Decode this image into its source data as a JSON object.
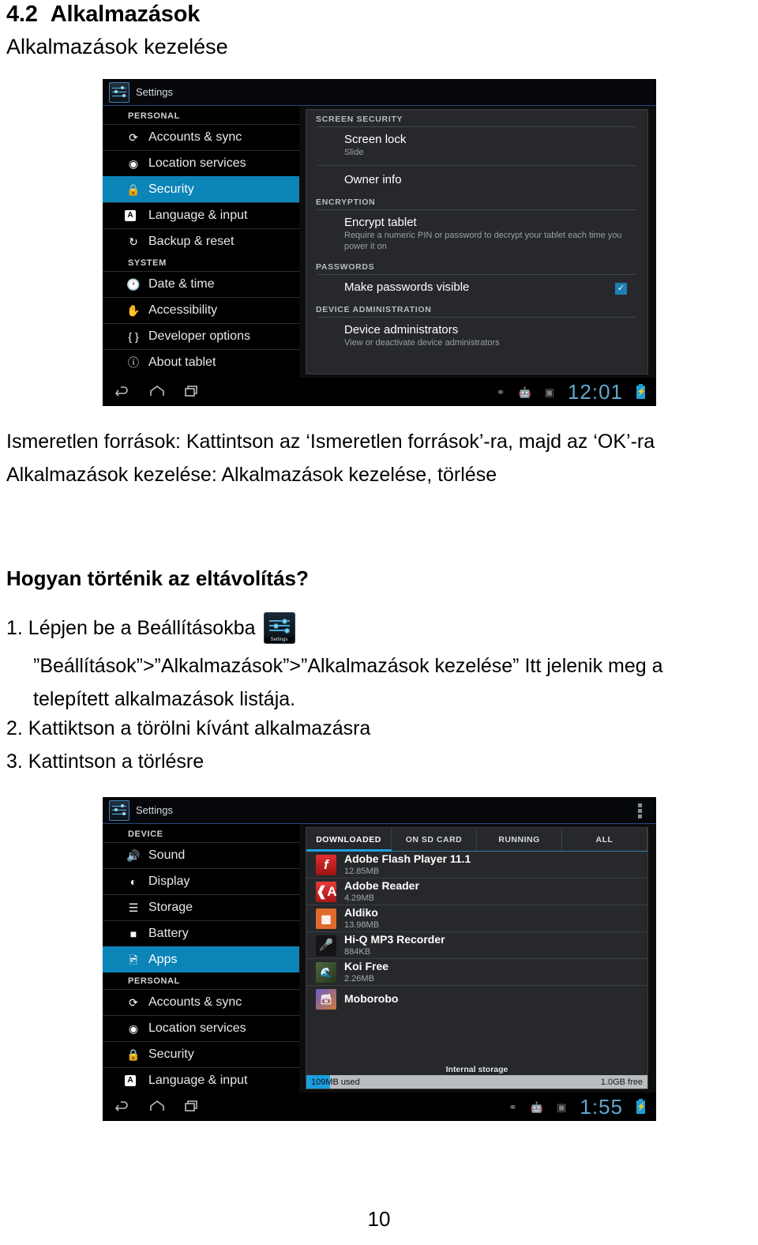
{
  "document": {
    "section_number": "4.2",
    "section_title": "Alkalmazások",
    "subtitle": "Alkalmazások kezelése",
    "paragraph_unknown_sources": "Ismeretlen források: Kattintson az ‘Ismeretlen források’-ra, majd az ‘OK’-ra",
    "paragraph_manage_apps": "Alkalmazások kezelése: Alkalmazások kezelése, törlése",
    "question_heading": "Hogyan történik az eltávolítás?",
    "step1_text": "1. Lépjen be a Beállításokba",
    "step1_icon_caption": "Settings",
    "step1_path": "”Beállítások”>”Alkalmazások”>”Alkalmazások kezelése” Itt jelenik meg a",
    "step1_path_cont": "telepített alkalmazások listája.",
    "step2_text": "2. Kattiktson a törölni kívánt alkalmazásra",
    "step3_text": "3. Kattintson a törlésre",
    "page_number": "10"
  },
  "colors": {
    "accent_blue": "#0b84b8",
    "tab_blue": "#1ca0e0",
    "clock_blue": "#5fa8cf",
    "panel_bg": "#26282b"
  },
  "screenshot_security": {
    "actionbar": {
      "title": "Settings",
      "icon": "settings-sliders-icon"
    },
    "sidebar": [
      {
        "type": "header",
        "label": "PERSONAL"
      },
      {
        "type": "item",
        "label": "Accounts & sync",
        "icon": "sync-icon",
        "selected": false
      },
      {
        "type": "item",
        "label": "Location services",
        "icon": "location-icon",
        "selected": false
      },
      {
        "type": "item",
        "label": "Security",
        "icon": "lock-icon",
        "selected": true
      },
      {
        "type": "item",
        "label": "Language & input",
        "icon": "keyboard-a-icon",
        "selected": false
      },
      {
        "type": "item",
        "label": "Backup & reset",
        "icon": "backup-restore-icon",
        "selected": false
      },
      {
        "type": "header",
        "label": "SYSTEM"
      },
      {
        "type": "item",
        "label": "Date & time",
        "icon": "clock-icon",
        "selected": false
      },
      {
        "type": "item",
        "label": "Accessibility",
        "icon": "hand-icon",
        "selected": false
      },
      {
        "type": "item",
        "label": "Developer options",
        "icon": "braces-icon",
        "selected": false
      },
      {
        "type": "item",
        "label": "About tablet",
        "icon": "info-icon",
        "selected": false
      }
    ],
    "content": [
      {
        "kind": "header",
        "label": "SCREEN SECURITY"
      },
      {
        "kind": "row",
        "title": "Screen lock",
        "subtitle": "Slide",
        "checkbox": null
      },
      {
        "kind": "row",
        "title": "Owner info",
        "subtitle": "",
        "checkbox": null
      },
      {
        "kind": "header",
        "label": "ENCRYPTION"
      },
      {
        "kind": "row",
        "title": "Encrypt tablet",
        "subtitle": "Require a numeric PIN or password to decrypt your tablet each time you power it on",
        "checkbox": null
      },
      {
        "kind": "header",
        "label": "PASSWORDS"
      },
      {
        "kind": "row",
        "title": "Make passwords visible",
        "subtitle": "",
        "checkbox": "checked"
      },
      {
        "kind": "header",
        "label": "DEVICE ADMINISTRATION"
      },
      {
        "kind": "row",
        "title": "Device administrators",
        "subtitle": "View or deactivate device administrators",
        "checkbox": null
      }
    ],
    "statusbar": {
      "clock": "12:01",
      "icons": [
        "usb-icon",
        "android-debug-icon",
        "sd-card-icon"
      ],
      "battery": "battery-charging-icon",
      "nav": [
        "back-icon",
        "home-icon",
        "recents-icon"
      ]
    }
  },
  "screenshot_apps": {
    "actionbar": {
      "title": "Settings",
      "icon": "settings-sliders-icon",
      "overflow": "overflow-menu-icon"
    },
    "sidebar": [
      {
        "type": "header",
        "label": "DEVICE"
      },
      {
        "type": "item",
        "label": "Sound",
        "icon": "speaker-icon",
        "selected": false
      },
      {
        "type": "item",
        "label": "Display",
        "icon": "brightness-icon",
        "selected": false
      },
      {
        "type": "item",
        "label": "Storage",
        "icon": "storage-icon",
        "selected": false
      },
      {
        "type": "item",
        "label": "Battery",
        "icon": "battery-icon",
        "selected": false
      },
      {
        "type": "item",
        "label": "Apps",
        "icon": "apps-icon",
        "selected": true
      },
      {
        "type": "header",
        "label": "PERSONAL"
      },
      {
        "type": "item",
        "label": "Accounts & sync",
        "icon": "sync-icon",
        "selected": false
      },
      {
        "type": "item",
        "label": "Location services",
        "icon": "location-icon",
        "selected": false
      },
      {
        "type": "item",
        "label": "Security",
        "icon": "lock-icon",
        "selected": false
      },
      {
        "type": "item",
        "label": "Language & input",
        "icon": "keyboard-a-icon",
        "selected": false
      }
    ],
    "tabs": [
      {
        "label": "DOWNLOADED",
        "active": true
      },
      {
        "label": "ON SD CARD",
        "active": false
      },
      {
        "label": "RUNNING",
        "active": false
      },
      {
        "label": "ALL",
        "active": false
      }
    ],
    "apps": [
      {
        "name": "Adobe Flash Player 11.1",
        "size": "12.85MB",
        "icon": "adobe-flash-icon",
        "icon_bg": "#c41f1f",
        "glyph": "f"
      },
      {
        "name": "Adobe Reader",
        "size": "4.29MB",
        "icon": "adobe-reader-icon",
        "icon_bg": "#d02020",
        "glyph": "A"
      },
      {
        "name": "Aldiko",
        "size": "13.98MB",
        "icon": "aldiko-books-icon",
        "icon_bg": "#e0622c",
        "glyph": "▤"
      },
      {
        "name": "Hi-Q MP3 Recorder",
        "size": "884KB",
        "icon": "microphone-icon",
        "icon_bg": "#1a1a1a",
        "glyph": "🎤"
      },
      {
        "name": "Koi Free",
        "size": "2.26MB",
        "icon": "koi-pond-icon",
        "icon_bg": "#3c5a35",
        "glyph": ""
      },
      {
        "name": "Moborobo",
        "size": "",
        "icon": "moborobo-icon",
        "icon_bg": "#2a2a2a",
        "glyph": ""
      }
    ],
    "storage": {
      "label": "Internal storage",
      "used": "109MB used",
      "free": "1.0GB free",
      "used_percent": 7
    },
    "statusbar": {
      "clock": "1:55",
      "icons": [
        "usb-icon",
        "android-debug-icon",
        "sd-card-icon"
      ],
      "battery": "battery-charging-icon",
      "nav": [
        "back-icon",
        "home-icon",
        "recents-icon"
      ]
    }
  }
}
